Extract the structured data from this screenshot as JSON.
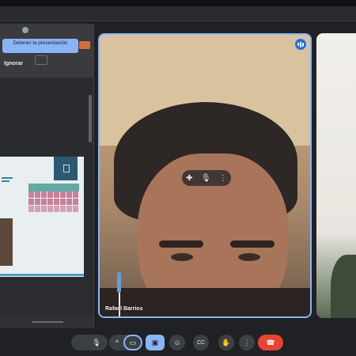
{
  "share": {
    "stop_label": "Detener la presentación",
    "ignore_label": "Ignorar"
  },
  "slide": {
    "table_header_color": "#63a9a3",
    "accent_color": "#2b5873"
  },
  "participant": {
    "name": "Rafael Barrios",
    "speaking_indicator": "audio-level-icon",
    "tile_border_color": "#8ab4f8"
  },
  "tile_controls": {
    "pin_icon": "pin-icon",
    "mic_icon": "mic-icon",
    "more_icon": "more-vert-icon"
  },
  "toolbar": {
    "items": [
      {
        "name": "more-dots-icon",
        "glyph": "⋯"
      },
      {
        "name": "mic-icon",
        "glyph": "🎙"
      },
      {
        "name": "chevron-up-icon",
        "glyph": "^"
      },
      {
        "name": "camera-icon",
        "glyph": "▭"
      },
      {
        "name": "present-icon",
        "glyph": "▣"
      },
      {
        "name": "emoji-icon",
        "glyph": "☺"
      },
      {
        "name": "captions-icon",
        "glyph": "CC"
      },
      {
        "name": "raise-hand-icon",
        "glyph": "✋"
      },
      {
        "name": "more-vert-icon",
        "glyph": "⋮"
      },
      {
        "name": "end-call-icon",
        "glyph": "☎"
      }
    ],
    "end_call_color": "#ea4335",
    "active_color": "#8ab4f8"
  }
}
